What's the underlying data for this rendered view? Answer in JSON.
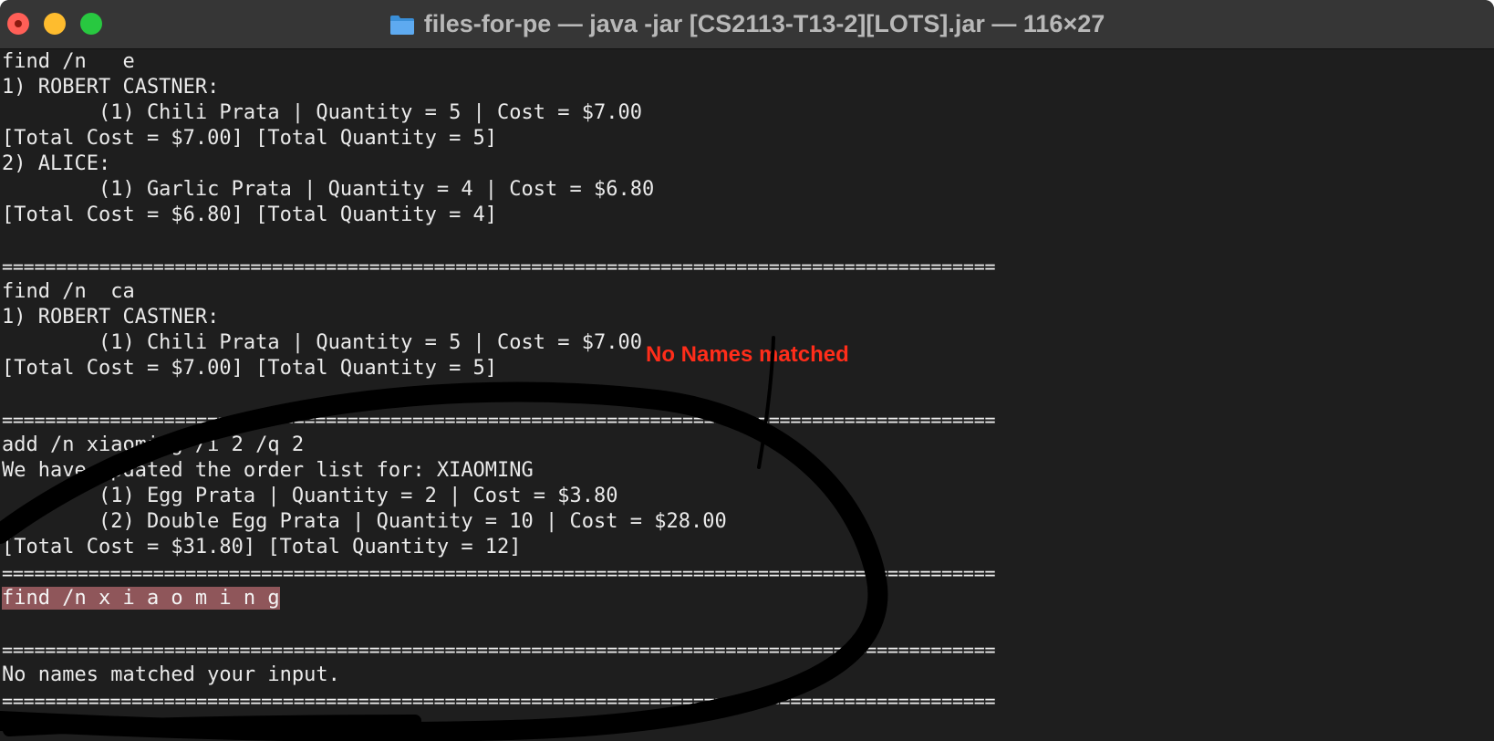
{
  "window": {
    "title": "files-for-pe — java -jar [CS2113-T13-2][LOTS].jar — 116×27"
  },
  "terminal": {
    "lines": [
      "find /n   e",
      "1) ROBERT CASTNER:",
      "        (1) Chili Prata | Quantity = 5 | Cost = $7.00",
      "[Total Cost = $7.00] [Total Quantity = 5]",
      "2) ALICE:",
      "        (1) Garlic Prata | Quantity = 4 | Cost = $6.80",
      "[Total Cost = $6.80] [Total Quantity = 4]",
      "",
      "============================================================================================",
      "find /n  ca",
      "1) ROBERT CASTNER:",
      "        (1) Chili Prata | Quantity = 5 | Cost = $7.00",
      "[Total Cost = $7.00] [Total Quantity = 5]",
      "",
      "============================================================================================",
      "add /n xiaoming /i 2 /q 2",
      "We have updated the order list for: XIAOMING",
      "        (1) Egg Prata | Quantity = 2 | Cost = $3.80",
      "        (2) Double Egg Prata | Quantity = 10 | Cost = $28.00",
      "[Total Cost = $31.80] [Total Quantity = 12]",
      "============================================================================================",
      "find /n x i a o m i n g",
      "",
      "============================================================================================",
      "No names matched your input.",
      "============================================================================================"
    ],
    "highlighted_line_index": 21
  },
  "annotation": {
    "text": "No Names matched",
    "color": "#ff2d1a",
    "ink_color": "#000000"
  },
  "colors": {
    "background": "#1e1e1e",
    "titlebar": "#363636",
    "highlight": "#8f565a",
    "close": "#ff5f57",
    "minimize": "#febc2e",
    "maximize": "#28c840"
  }
}
